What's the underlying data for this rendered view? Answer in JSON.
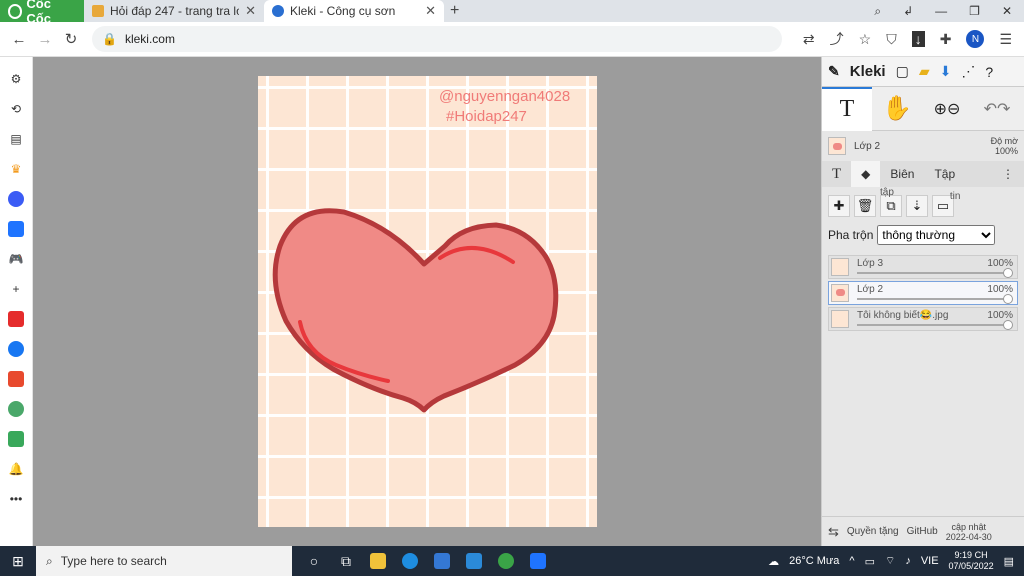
{
  "browser": {
    "brand": "Cốc Cốc",
    "tabs": [
      {
        "title": "Hỏi đáp 247 - trang tra loi",
        "active": false
      },
      {
        "title": "Kleki - Công cụ sơn",
        "active": true
      }
    ],
    "url": "kleki.com",
    "profile_initial": "N"
  },
  "canvas": {
    "watermark_line1": "@nguyenngan4028",
    "watermark_line2": "#Hoidap247"
  },
  "kleki": {
    "logo": "Kleki",
    "current_layer": "Lớp 2",
    "opacity_label": "Độ mờ",
    "opacity_value": "100%",
    "tabs": [
      "Biên",
      "Tập"
    ],
    "tab_tap_sub": "tập",
    "tab_tin": "tin",
    "blend_label": "Pha trộn",
    "blend_value": "thông thường",
    "layers": [
      {
        "name": "Lớp 3",
        "opacity": "100%",
        "selected": false
      },
      {
        "name": "Lớp 2",
        "opacity": "100%",
        "selected": true
      },
      {
        "name": "Tôi không biết😂.jpg",
        "opacity": "100%",
        "selected": false
      }
    ],
    "footer": {
      "credits": "Quyền tặng",
      "github": "GitHub",
      "update_label": "cập nhật",
      "update_date": "2022-04-30"
    }
  },
  "taskbar": {
    "search_placeholder": "Type here to search",
    "weather": "26°C Mưa",
    "lang": "VIE",
    "time": "9:19 CH",
    "date": "07/05/2022"
  },
  "colors": {
    "browser_brand": "#3aa447",
    "accent": "#2a7ad7",
    "heart_fill": "#f08a86",
    "heart_stroke": "#b5393b",
    "paper": "#fde6d4"
  }
}
